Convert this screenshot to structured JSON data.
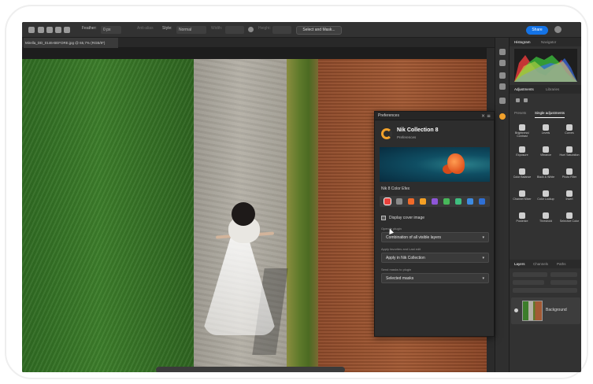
{
  "app": {
    "doc_tab": "Mirella_DD_0146-BEFORE.jpg @ 65,7% (RGB/8*)",
    "options_bar": {
      "feather_label": "Feather:",
      "feather_value": "0 px",
      "antialias_label": "Anti-alias",
      "style_label": "Style:",
      "style_value": "Normal",
      "width_label": "Width:",
      "height_label": "Height:",
      "select_mask_label": "Select and Mask...",
      "share_label": "Share"
    }
  },
  "right_panel": {
    "top_tabs": [
      "Histogram",
      "Navigator"
    ],
    "mid_tabs": [
      "Adjustments",
      "Libraries"
    ],
    "adj_tabs": [
      "Presets",
      "Single adjustments"
    ],
    "adjustments": [
      "Brightness/ Contrast",
      "Levels",
      "Curves",
      "Exposure",
      "Vibrance",
      "Hue/ Saturation",
      "Color Balance",
      "Black & White",
      "Photo Filter",
      "Channel Mixer",
      "Color Lookup",
      "Invert",
      "Posterize",
      "Threshold",
      "Selective Color"
    ],
    "layer_tabs": [
      "Layers",
      "Channels",
      "Paths"
    ],
    "layer_name": "Background"
  },
  "preferences": {
    "window_title": "Preferences",
    "product_title": "Nik Collection 8",
    "product_subtitle": "Preferences",
    "selected_product": "Nik 8 Color Efex",
    "swatch_colors": [
      "#e8413c",
      "#8a8a8a",
      "#f06a2a",
      "#f4a025",
      "#8e56d8",
      "#48b85a",
      "#3fbf7f",
      "#3e8be0",
      "#2f6fd4"
    ],
    "display_cover_label": "Display cover image",
    "open_in_plugin_label": "Open in plugin",
    "open_in_plugin_value": "Combination of all visible layers",
    "apply_favorites_label": "Apply favorites and Last edit",
    "apply_favorites_value": "Apply in Nik Collection",
    "send_masks_label": "Send masks to plugin",
    "send_masks_value": "Selected masks"
  },
  "colors": {
    "accent": "#1473e6",
    "nik_orange": "#f2a22c",
    "panel_bg": "#323232"
  }
}
